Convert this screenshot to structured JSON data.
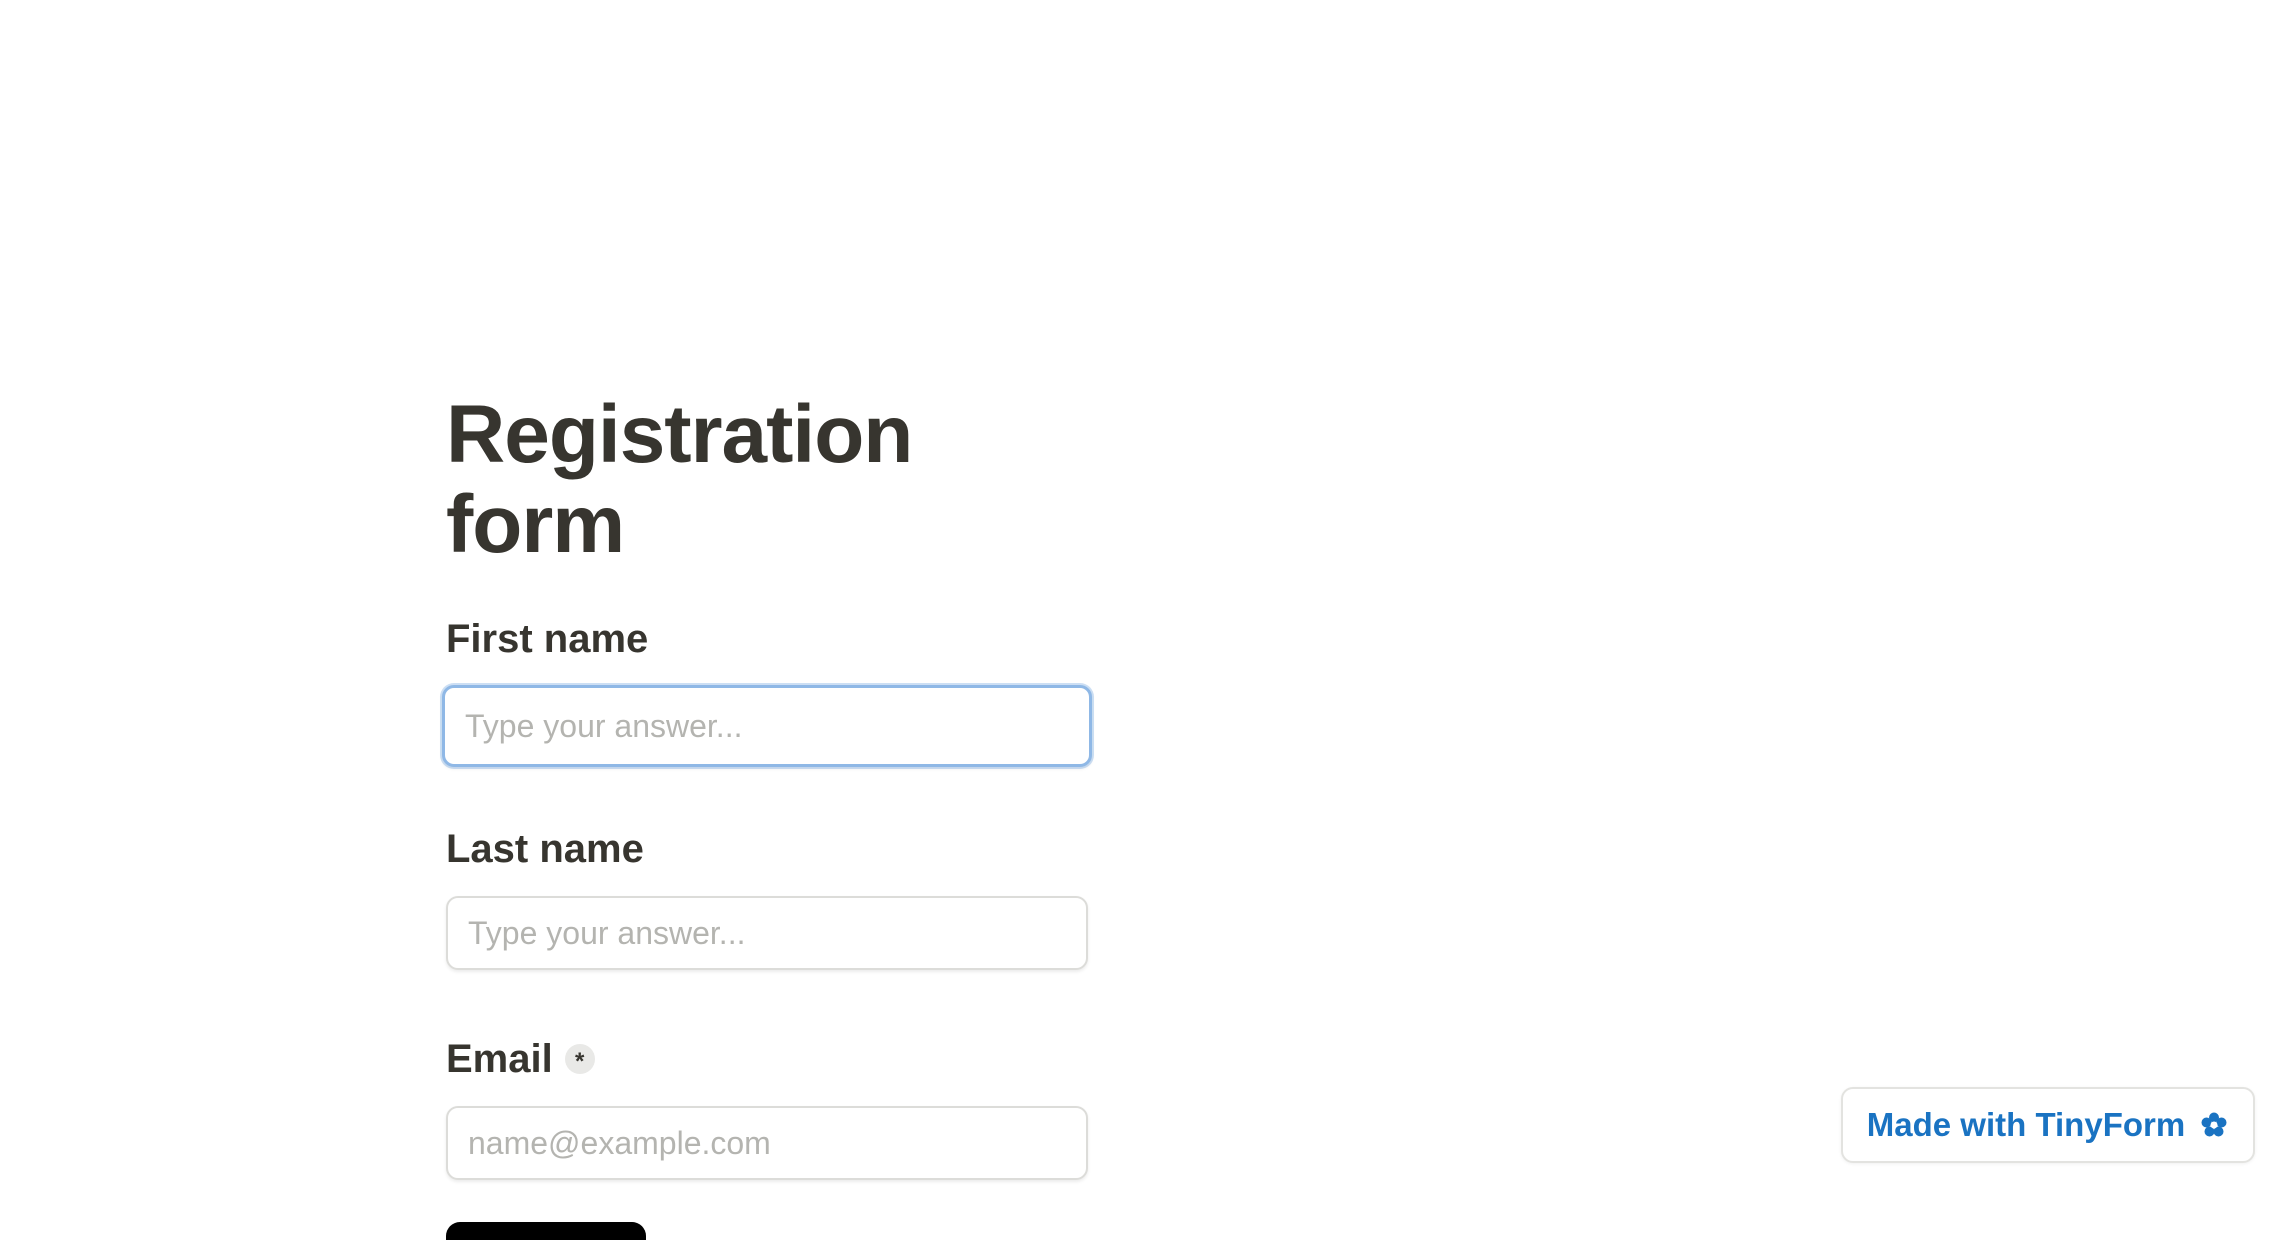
{
  "form": {
    "title": "Registration form",
    "fields": [
      {
        "label": "First name",
        "placeholder": "Type your answer...",
        "value": "",
        "required": false,
        "focused": true
      },
      {
        "label": "Last name",
        "placeholder": "Type your answer...",
        "value": "",
        "required": false,
        "focused": false
      },
      {
        "label": "Email",
        "placeholder": "name@example.com",
        "value": "",
        "required": true,
        "required_marker": "*",
        "focused": false
      }
    ],
    "submit_label": ""
  },
  "branding": {
    "badge_text": "Made with TinyForm",
    "badge_icon": "flower-icon",
    "accent_color": "#1a73c2"
  },
  "colors": {
    "text": "#37352f",
    "focus_ring": "#8fb8e6",
    "submit_background": "#000000"
  }
}
